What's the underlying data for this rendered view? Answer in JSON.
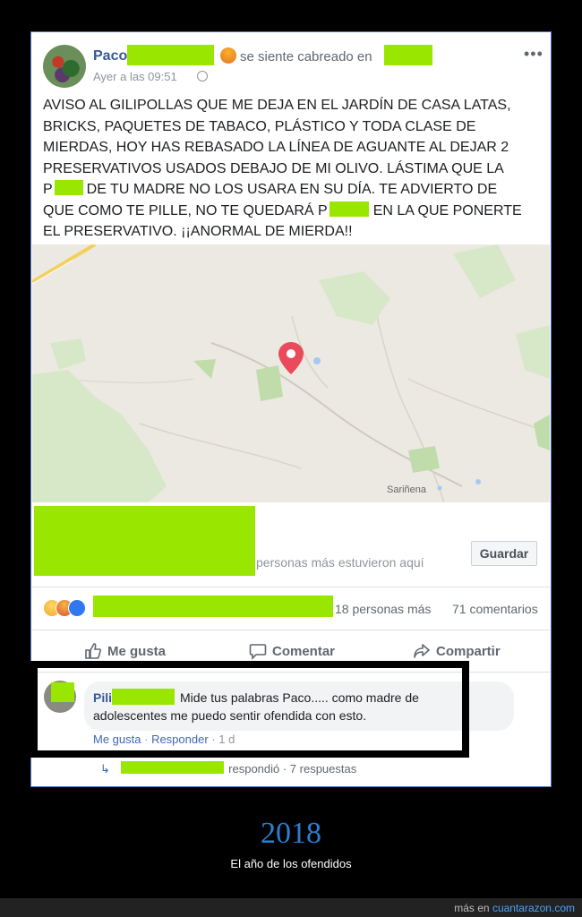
{
  "post": {
    "author": "Paco",
    "feeling": "se siente cabreado en",
    "timestamp": "Ayer a las 09:51",
    "more_label": "•••",
    "lines": [
      "AVISO AL GILIPOLLAS QUE ME DEJA EN EL JARDÍN DE CASA LATAS,",
      "BRICKS, PAQUETES DE TABACO, PLÁSTICO Y TODA CLASE DE",
      "MIERDAS, HOY HAS REBASADO LA LÍNEA DE AGUANTE AL DEJAR 2",
      "PRESERVATIVOS USADOS DEBAJO DE MI OLIVO. LÁSTIMA QUE LA",
      "P",
      "DE TU MADRE NO LOS USARA EN SU DÍA. TE ADVIERTO DE",
      "QUE COMO TE PILLE, NO TE QUEDARÁ P",
      "EN LA QUE PONERTE",
      "EL PRESERVATIVO. ¡¡ANORMAL DE MIERDA!!"
    ]
  },
  "map": {
    "town_label": "Sariñena"
  },
  "location": {
    "visitors_text": "personas más estuvieron aquí",
    "save_label": "Guardar"
  },
  "reactions": {
    "others_text": "18 personas más",
    "comments_count": "71 comentarios"
  },
  "actions": {
    "like": "Me gusta",
    "comment": "Comentar",
    "share": "Compartir"
  },
  "comment": {
    "author": "Pili",
    "text": "Mide tus palabras Paco..... como madre de adolescentes me puedo sentir ofendida con esto.",
    "like": "Me gusta",
    "reply": "Responder",
    "age": "1 d",
    "replies_text": "respondió · 7 respuestas"
  },
  "caption": {
    "year": "2018",
    "subtitle": "El año de los ofendidos"
  },
  "footer": {
    "prefix": "más en",
    "site": "cuantarazon.com"
  }
}
